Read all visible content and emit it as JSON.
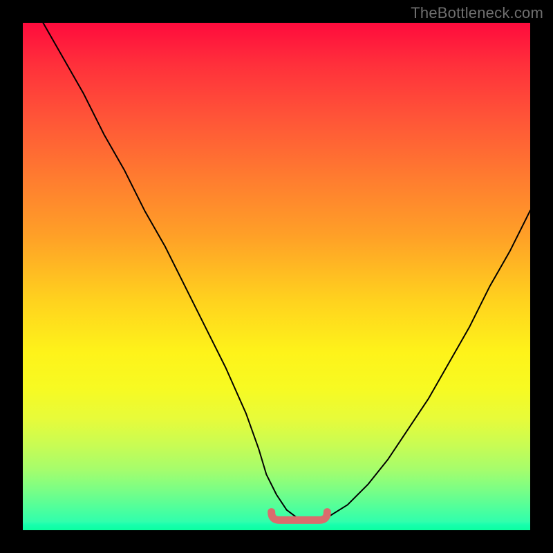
{
  "attribution": "TheBottleneck.com",
  "colors": {
    "page_bg": "#000000",
    "gradient_top": "#ff0b3d",
    "gradient_bottom": "#1effb6",
    "curve": "#000000",
    "flat_marker": "#d96d6d",
    "attribution_text": "#6f6f6f"
  },
  "chart_data": {
    "type": "line",
    "title": "",
    "xlabel": "",
    "ylabel": "",
    "xlim": [
      0,
      100
    ],
    "ylim": [
      0,
      100
    ],
    "series": [
      {
        "name": "bottleneck-curve",
        "x": [
          4,
          8,
          12,
          16,
          20,
          24,
          28,
          32,
          36,
          40,
          44,
          46.5,
          48,
          50,
          52,
          54,
          56,
          57.5,
          60,
          64,
          68,
          72,
          76,
          80,
          84,
          88,
          92,
          96,
          100
        ],
        "y": [
          100,
          93,
          86,
          78,
          71,
          63,
          56,
          48,
          40,
          32,
          23,
          16,
          11,
          7,
          4,
          2.5,
          2,
          2,
          2.5,
          5,
          9,
          14,
          20,
          26,
          33,
          40,
          48,
          55,
          63
        ]
      }
    ],
    "flat_segment": {
      "x_start": 49,
      "x_end": 60,
      "y": 2
    }
  }
}
